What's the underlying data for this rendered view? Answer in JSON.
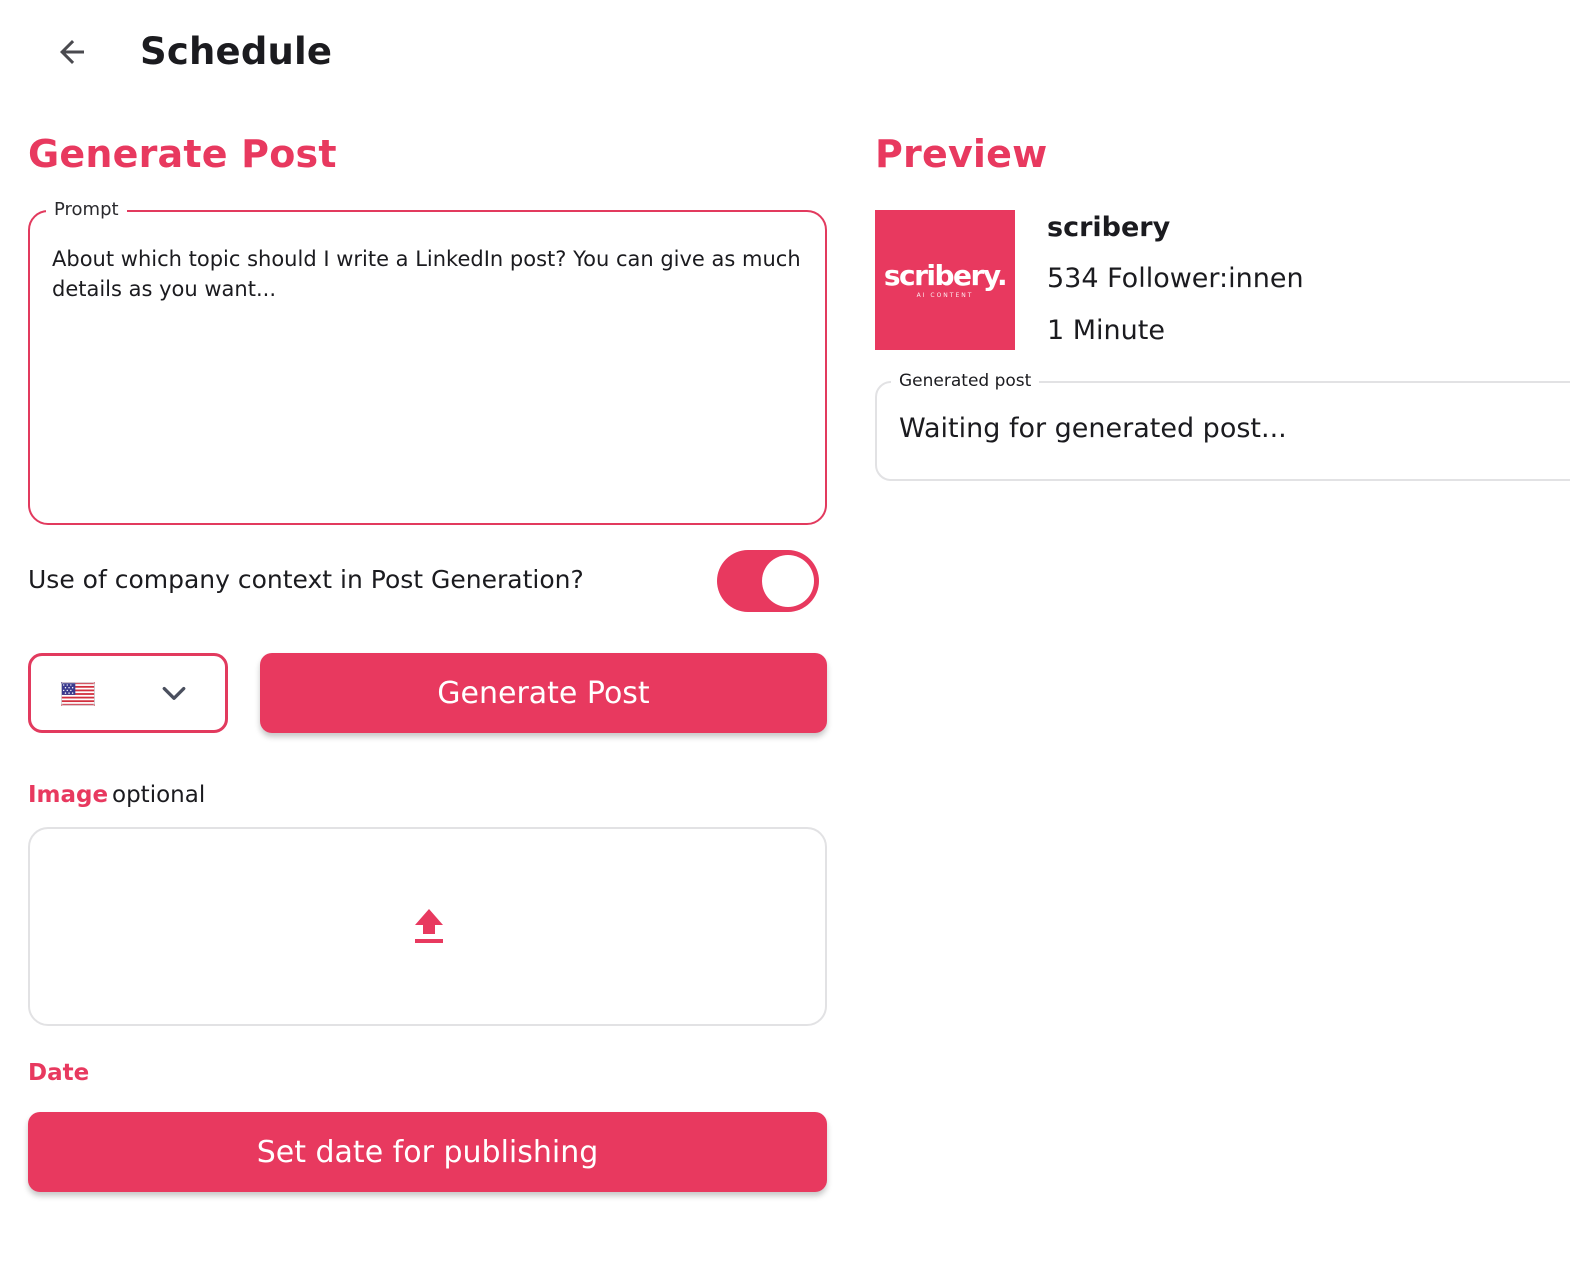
{
  "header": {
    "title": "Schedule",
    "back_icon": "arrow-left-icon"
  },
  "generate": {
    "section_title": "Generate Post",
    "prompt": {
      "label": "Prompt",
      "placeholder": "About which topic should I write a LinkedIn post? You can give as much details as  you want..."
    },
    "company_context": {
      "label": "Use of  company context in Post Generation?",
      "enabled": true
    },
    "language": {
      "selected_icon": "us-flag-icon",
      "dropdown_icon": "chevron-down-icon"
    },
    "generate_button": "Generate Post",
    "image": {
      "label": "Image",
      "optional_text": "optional",
      "upload_icon": "upload-icon"
    },
    "date": {
      "label": "Date",
      "button": "Set date for publishing"
    }
  },
  "preview": {
    "section_title": "Preview",
    "logo_text": "scribery.",
    "logo_subtext": "AI CONTENT",
    "profile_name": "scribery",
    "followers": "534 Follower:innen",
    "time": "1 Minute",
    "generated_post": {
      "label": "Generated post",
      "text": "Waiting for generated post..."
    }
  },
  "colors": {
    "accent": "#e8395f",
    "text": "#1b1b1f",
    "border_muted": "#e2e2e4"
  }
}
